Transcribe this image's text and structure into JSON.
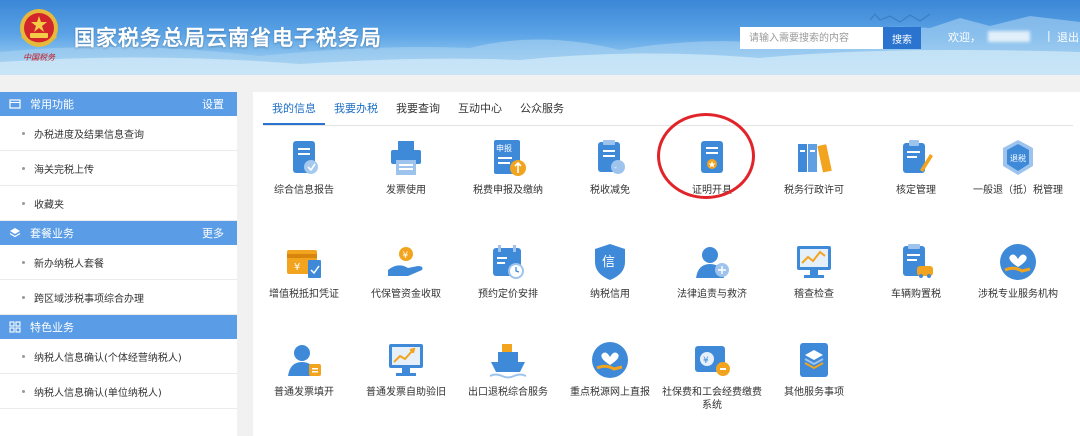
{
  "header": {
    "emblem_text": "中国税务",
    "title": "国家税务总局云南省电子税务局",
    "search_placeholder": "请输入需要搜索的内容",
    "search_button": "搜索",
    "welcome": "欢迎，",
    "separator": "|",
    "logout": "退出"
  },
  "sidebar": {
    "sections": [
      {
        "title": "常用功能",
        "action": "设置",
        "items": [
          "办税进度及结果信息查询",
          "海关完税上传",
          "收藏夹"
        ]
      },
      {
        "title": "套餐业务",
        "action": "更多",
        "items": [
          "新办纳税人套餐",
          "跨区域涉税事项综合办理"
        ]
      },
      {
        "title": "特色业务",
        "action": "",
        "items": [
          "纳税人信息确认(个体经营纳税人)",
          "纳税人信息确认(单位纳税人)"
        ]
      }
    ]
  },
  "tabs": [
    "我的信息",
    "我要办税",
    "我要查询",
    "互动中心",
    "公众服务"
  ],
  "services": [
    {
      "label": "综合信息报告",
      "icon": "report-icon"
    },
    {
      "label": "发票使用",
      "icon": "printer-icon"
    },
    {
      "label": "税费申报及缴纳",
      "icon": "declare-pay-icon"
    },
    {
      "label": "税收减免",
      "icon": "tax-relief-icon"
    },
    {
      "label": "证明开具",
      "icon": "certificate-icon"
    },
    {
      "label": "税务行政许可",
      "icon": "binders-icon"
    },
    {
      "label": "核定管理",
      "icon": "clipboard-pen-icon"
    },
    {
      "label": "一般退（抵）税管理",
      "icon": "refund-icon",
      "icon_text": "退税"
    },
    {
      "label": "增值税抵扣凭证",
      "icon": "vat-voucher-icon"
    },
    {
      "label": "代保管资金收取",
      "icon": "hand-coin-icon"
    },
    {
      "label": "预约定价安排",
      "icon": "calendar-clock-icon"
    },
    {
      "label": "纳税信用",
      "icon": "credit-icon",
      "icon_text": "信"
    },
    {
      "label": "法律追责与救济",
      "icon": "law-person-icon"
    },
    {
      "label": "稽查检查",
      "icon": "monitor-chart-icon"
    },
    {
      "label": "车辆购置税",
      "icon": "vehicle-tax-icon"
    },
    {
      "label": "涉税专业服务机构",
      "icon": "heart-hand-icon"
    },
    {
      "label": "普通发票填开",
      "icon": "person-invoice-icon"
    },
    {
      "label": "普通发票自助验旧",
      "icon": "monitor-trend-icon"
    },
    {
      "label": "出口退税综合服务",
      "icon": "ship-icon"
    },
    {
      "label": "重点税源网上直报",
      "icon": "heart-hand-report-icon"
    },
    {
      "label": "社保费和工会经费缴费系统",
      "icon": "social-insurance-icon"
    },
    {
      "label": "其他服务事项",
      "icon": "layers-icon"
    }
  ],
  "colors": {
    "header_blue": "#3b86d6",
    "sidebar_header": "#5a9de6",
    "accent": "#2a74d0",
    "highlight_circle": "#e1242a",
    "icon_blue": "#3f8ad8",
    "icon_orange": "#f2a41e"
  }
}
